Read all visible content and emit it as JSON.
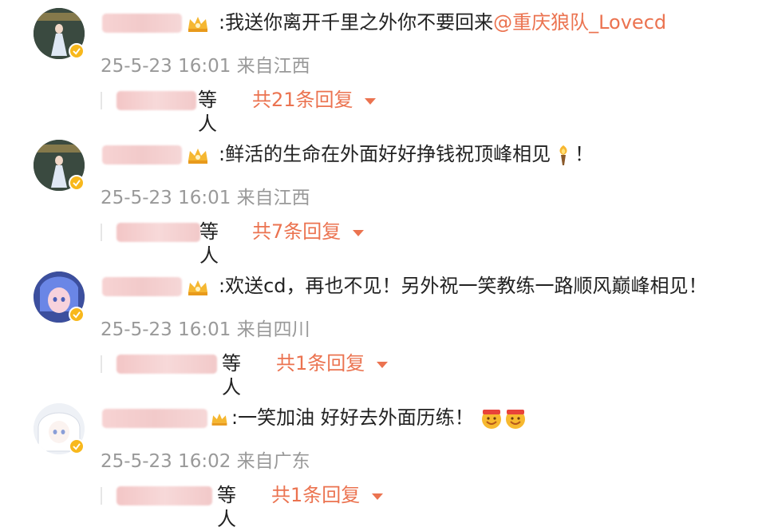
{
  "comments": [
    {
      "content_text": ":我送你离开千里之外你不要回来",
      "mention": "@重庆狼队_Lovecd",
      "trailing": "",
      "time": "25-5-23 16:01",
      "location": "来自江西",
      "reply_etc": "等人",
      "reply_count": "共21条回复"
    },
    {
      "content_text": ":鲜活的生命在外面好好挣钱祝顶峰相见",
      "mention": "",
      "trailing": "！",
      "time": "25-5-23 16:01",
      "location": "来自江西",
      "reply_etc": "等人",
      "reply_count": "共7条回复"
    },
    {
      "content_text": ":欢送cd，再也不见！另外祝一笑教练一路顺风巅峰相见！",
      "mention": "",
      "trailing": "",
      "time": "25-5-23 16:01",
      "location": "来自四川",
      "reply_etc": "等人",
      "reply_count": "共1条回复"
    },
    {
      "content_text": ":一笑加油 好好去外面历练！",
      "mention": "",
      "trailing": "",
      "time": "25-5-23 16:02",
      "location": "来自广东",
      "reply_etc": "等人",
      "reply_count": "共1条回复"
    }
  ],
  "colors": {
    "accent": "#eb7350",
    "meta": "#999999",
    "verified_badge": "#f8b81c"
  },
  "icons": [
    "crown-icon",
    "verified-icon",
    "caret-down-icon",
    "torch-emoji-icon",
    "cheer-emoji-icon"
  ]
}
